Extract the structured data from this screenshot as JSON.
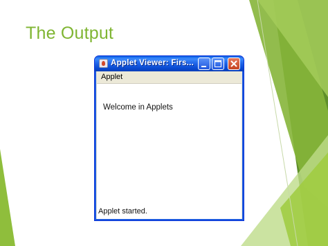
{
  "slide": {
    "title": "The Output"
  },
  "window": {
    "title": "Applet Viewer: Firs...",
    "menu": [
      "Applet"
    ],
    "content_text": "Welcome in Applets",
    "status_text": "Applet started."
  },
  "colors": {
    "title_green": "#7fb532",
    "titlebar_blue": "#1e62e6",
    "close_red": "#c5421f"
  },
  "icons": [
    "java-cup-icon",
    "minimize-icon",
    "maximize-icon",
    "close-icon"
  ]
}
